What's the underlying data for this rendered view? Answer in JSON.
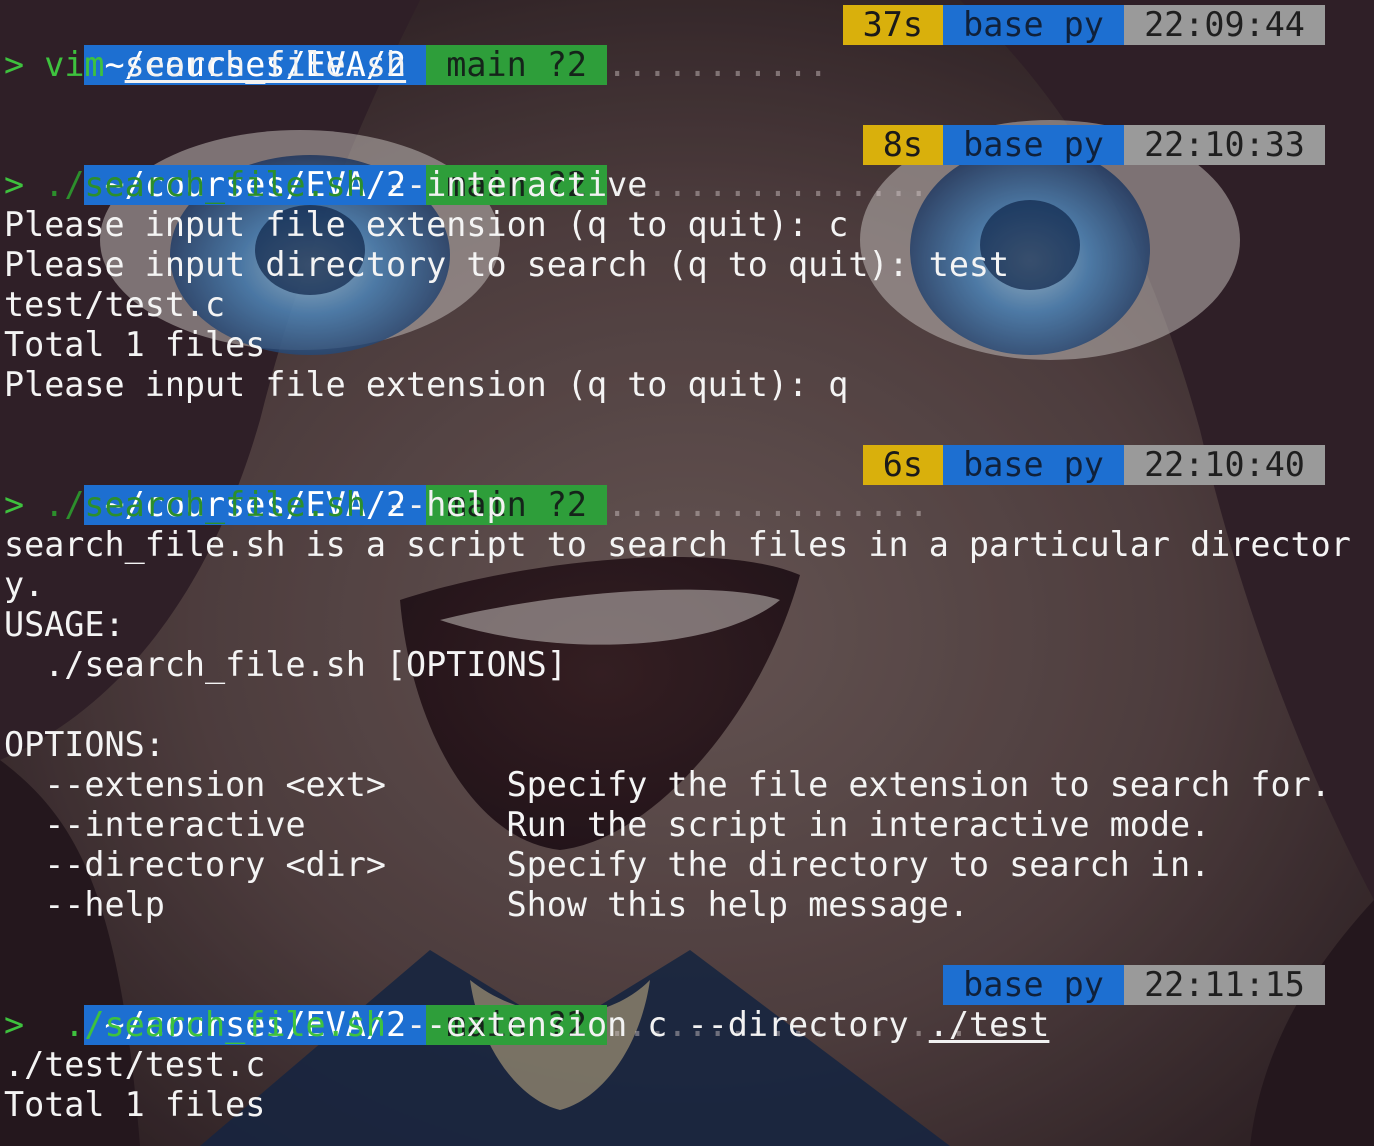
{
  "colors": {
    "dir_segment": "#1d6fd1",
    "git_segment": "#2e9e3a",
    "duration_segment": "#d9b00c",
    "env_segment": "#1d6fd1",
    "clock_segment": "#9a9a9a",
    "prompt_arrow": "#3ec23e"
  },
  "prompts": [
    {
      "dir": " ~/courses/EVA/2 ",
      "git": " main ?2 ",
      "dots": "...........",
      "duration": " 37s ",
      "env": " base py ",
      "time": " 22:09:44 ",
      "arrow": ">",
      "cmd": "vim",
      "arg": "search_file.sh"
    },
    {
      "dir": " ~/courses/EVA/2 ",
      "git": " main ?2 ",
      "dots": "................",
      "duration": " 8s ",
      "env": " base py ",
      "time": " 22:10:33 ",
      "arrow": ">",
      "cmd": "./search_file.sh",
      "arg": "--interactive"
    },
    {
      "dir": " ~/courses/EVA/2 ",
      "git": " main ?2 ",
      "dots": "................",
      "duration": " 6s ",
      "env": " base py ",
      "time": " 22:10:40 ",
      "arrow": ">",
      "cmd": "./search_file.sh",
      "arg": "--help"
    },
    {
      "dir": " ~/courses/EVA/2 ",
      "git": " main ?2 ",
      "dots": "....................",
      "env": " base py ",
      "time": " 22:11:15 ",
      "arrow": ">",
      "cmd": " ./search_file.sh",
      "arg1": "--extension c --directory",
      "arg2": "./test"
    }
  ],
  "output": {
    "interactive": [
      "Please input file extension (q to quit): c",
      "Please input directory to search (q to quit): test",
      "test/test.c",
      "Total 1 files",
      "Please input file extension (q to quit): q"
    ],
    "help": [
      "search_file.sh is a script to search files in a particular director",
      "y.",
      "USAGE:",
      "  ./search_file.sh [OPTIONS]",
      "",
      "OPTIONS:",
      "  --extension <ext>      Specify the file extension to search for.",
      "  --interactive          Run the script in interactive mode.",
      "  --directory <dir>      Specify the directory to search in.",
      "  --help                 Show this help message."
    ],
    "search": [
      "./test/test.c",
      "Total 1 files"
    ]
  }
}
